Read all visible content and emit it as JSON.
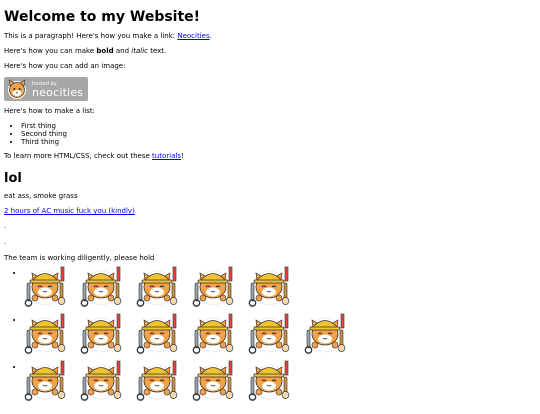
{
  "heading": "Welcome to my Website!",
  "paragraph1": {
    "before": "This is a paragraph! Here's how you make a link: ",
    "link": "Neocities",
    "after": "."
  },
  "paragraph2": {
    "before": "Here's how you can make ",
    "bold": "bold",
    "middle": " and ",
    "italic": "italic",
    "after": " text."
  },
  "paragraph3": "Here's how you can add an image:",
  "badge": {
    "small": "hosted by",
    "big": "neocities"
  },
  "paragraph4": "Here's how to make a list:",
  "list": [
    "First thing",
    "Second thing",
    "Third thing"
  ],
  "paragraph5": {
    "before": "To learn more HTML/CSS, check out these ",
    "link": "tutorials",
    "after": "!"
  },
  "heading2": "lol",
  "paragraph6": "eat ass, smoke grass",
  "link2": "2 hours of AC music fuck you (kindly)",
  "dot1": ".",
  "dot2": ".",
  "paragraph7": "The team is working diligently, please hold",
  "worker_rows": [
    5,
    6,
    5
  ],
  "colors": {
    "link": "#0000ee",
    "badge": "#a7a7a7",
    "cat": "#f4a24a",
    "helmet": "#f2c230"
  }
}
